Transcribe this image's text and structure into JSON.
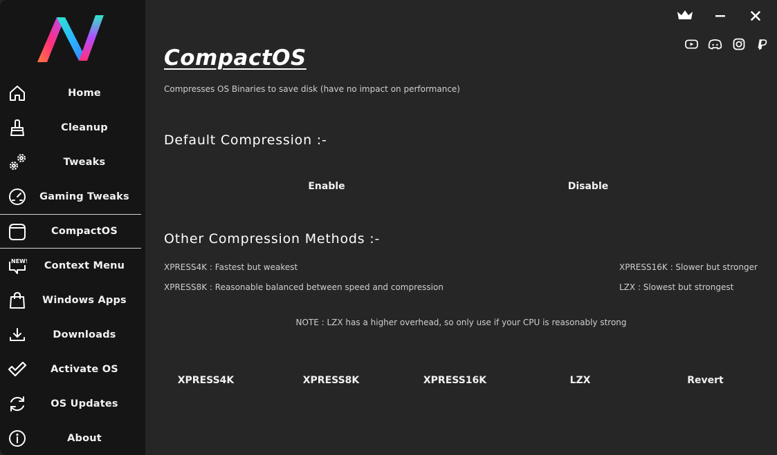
{
  "sidebar": {
    "items": [
      {
        "label": "Home",
        "icon": "home-icon"
      },
      {
        "label": "Cleanup",
        "icon": "broom-icon"
      },
      {
        "label": "Tweaks",
        "icon": "gears-icon"
      },
      {
        "label": "Gaming Tweaks",
        "icon": "speedometer-icon"
      },
      {
        "label": "CompactOS",
        "icon": "compact-icon"
      },
      {
        "label": "Context Menu",
        "icon": "chat-new-icon"
      },
      {
        "label": "Windows Apps",
        "icon": "bag-icon"
      },
      {
        "label": "Downloads",
        "icon": "download-icon"
      },
      {
        "label": "Activate OS",
        "icon": "check-icon"
      },
      {
        "label": "OS Updates",
        "icon": "refresh-icon"
      },
      {
        "label": "About",
        "icon": "info-icon"
      }
    ],
    "active_index": 4,
    "new_badge": "NEW!"
  },
  "page": {
    "title": "CompactOS",
    "description": "Compresses OS Binaries to save disk (have no impact on performance)"
  },
  "default_compression": {
    "heading": "Default Compression :-",
    "enable_label": "Enable",
    "disable_label": "Disable"
  },
  "other_methods": {
    "heading": "Other Compression Methods :-",
    "xpress4k_desc": "XPRESS4K : Fastest but weakest",
    "xpress8k_desc": "XPRESS8K : Reasonable balanced between speed and compression",
    "xpress16k_desc": "XPRESS16K : Slower but stronger",
    "lzx_desc": "LZX : Slowest but strongest",
    "note": "NOTE : LZX has a higher overhead, so only use if your CPU is reasonably strong"
  },
  "actions": {
    "xpress4k": "XPRESS4K",
    "xpress8k": "XPRESS8K",
    "xpress16k": "XPRESS16K",
    "lzx": "LZX",
    "revert": "Revert"
  },
  "colors": {
    "sidebar_bg": "#151515",
    "main_bg": "#262626",
    "text": "#ffffff",
    "logo_gradient": [
      "#ff3d6e",
      "#b84bff",
      "#2de0d0"
    ]
  }
}
